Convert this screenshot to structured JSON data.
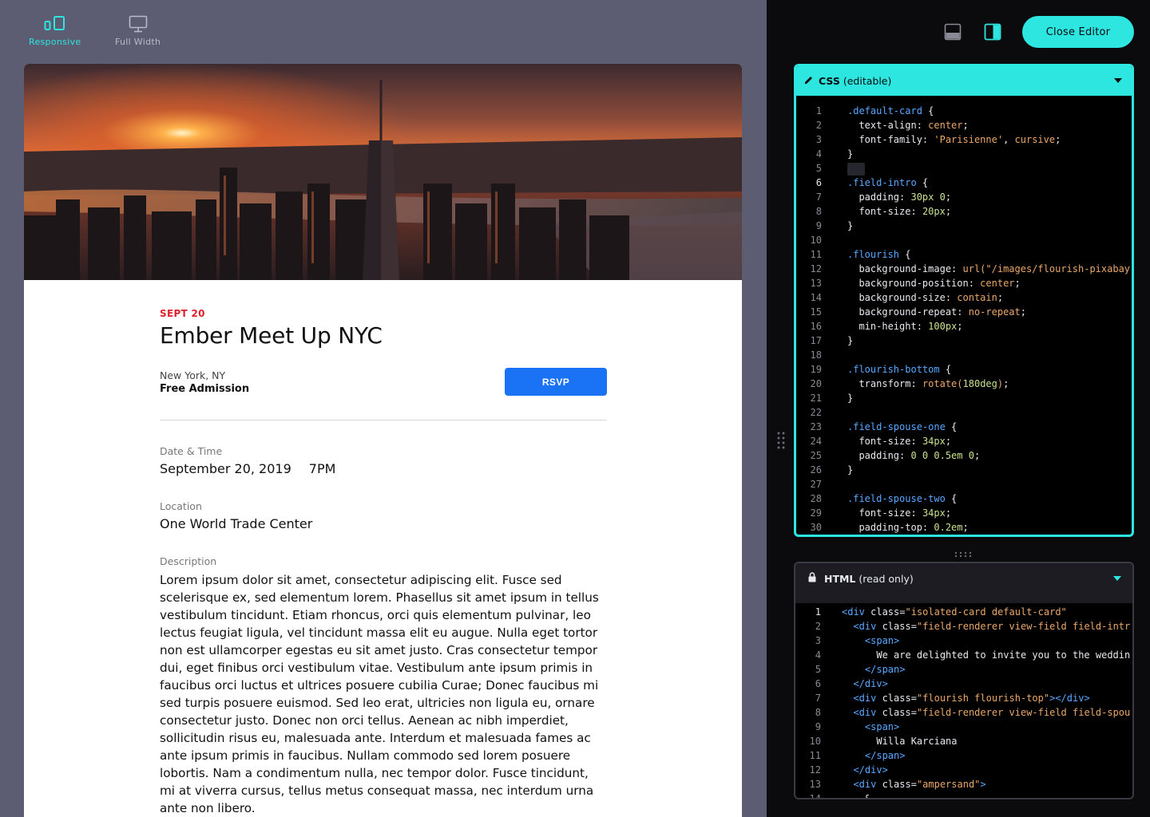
{
  "toolbar": {
    "responsive_label": "Responsive",
    "full_width_label": "Full Width",
    "close_editor_label": "Close Editor"
  },
  "event": {
    "date_tag": "SEPT 20",
    "title": "Ember Meet Up NYC",
    "city": "New York, NY",
    "admission": "Free Admission",
    "rsvp_label": "RSVP",
    "date_time_label": "Date & Time",
    "date_value": "September 20, 2019",
    "time_value": "7PM",
    "location_label": "Location",
    "location_value": "One World Trade Center",
    "description_label": "Description",
    "description": "Lorem ipsum dolor sit amet, consectetur adipiscing elit. Fusce sed scelerisque ex, sed elementum lorem. Phasellus sit amet ipsum in tellus vestibulum tincidunt. Etiam rhoncus, orci quis elementum pulvinar, leo lectus feugiat ligula, vel tincidunt massa elit eu augue. Nulla eget tortor non est ullamcorper egestas eu sit amet justo. Cras consectetur tempor dui, eget finibus orci vestibulum vitae. Vestibulum ante ipsum primis in faucibus orci luctus et ultrices posuere cubilia Curae; Donec faucibus mi sed turpis posuere euismod. Sed leo erat, ultricies non ligula eu, ornare consectetur justo. Donec non orci tellus. Aenean ac nibh imperdiet, sollicitudin risus eu, malesuada ante. Interdum et malesuada fames ac ante ipsum primis in faucibus. Nullam commodo sed lorem posuere lobortis. Nam a condimentum nulla, nec tempor dolor. Fusce tincidunt, mi at viverra cursus, tellus metus consequat massa, nec interdum urna ante non libero."
  },
  "css_pane": {
    "title": "CSS",
    "subtitle": "(editable)",
    "current_line": 6,
    "lines": [
      [
        [
          "sel",
          ".default-card"
        ],
        [
          "punc",
          " {"
        ]
      ],
      [
        [
          "prop",
          "  text-align"
        ],
        [
          "punc",
          ": "
        ],
        [
          "val",
          "center"
        ],
        [
          "punc",
          ";"
        ]
      ],
      [
        [
          "prop",
          "  font-family"
        ],
        [
          "punc",
          ": "
        ],
        [
          "val",
          "'Parisienne'"
        ],
        [
          "punc",
          ", "
        ],
        [
          "val",
          "cursive"
        ],
        [
          "punc",
          ";"
        ]
      ],
      [
        [
          "punc",
          "}"
        ]
      ],
      [],
      [
        [
          "sel",
          ".field-intro"
        ],
        [
          "punc",
          " {"
        ]
      ],
      [
        [
          "prop",
          "  padding"
        ],
        [
          "punc",
          ": "
        ],
        [
          "num",
          "30px 0"
        ],
        [
          "punc",
          ";"
        ]
      ],
      [
        [
          "prop",
          "  font-size"
        ],
        [
          "punc",
          ": "
        ],
        [
          "num",
          "20px"
        ],
        [
          "punc",
          ";"
        ]
      ],
      [
        [
          "punc",
          "}"
        ]
      ],
      [],
      [
        [
          "sel",
          ".flourish"
        ],
        [
          "punc",
          " {"
        ]
      ],
      [
        [
          "prop",
          "  background-image"
        ],
        [
          "punc",
          ": "
        ],
        [
          "fn",
          "url("
        ],
        [
          "val",
          "\"/images/flourish-pixabay-"
        ]
      ],
      [
        [
          "prop",
          "  background-position"
        ],
        [
          "punc",
          ": "
        ],
        [
          "val",
          "center"
        ],
        [
          "punc",
          ";"
        ]
      ],
      [
        [
          "prop",
          "  background-size"
        ],
        [
          "punc",
          ": "
        ],
        [
          "val",
          "contain"
        ],
        [
          "punc",
          ";"
        ]
      ],
      [
        [
          "prop",
          "  background-repeat"
        ],
        [
          "punc",
          ": "
        ],
        [
          "val",
          "no-repeat"
        ],
        [
          "punc",
          ";"
        ]
      ],
      [
        [
          "prop",
          "  min-height"
        ],
        [
          "punc",
          ": "
        ],
        [
          "num",
          "100px"
        ],
        [
          "punc",
          ";"
        ]
      ],
      [
        [
          "punc",
          "}"
        ]
      ],
      [],
      [
        [
          "sel",
          ".flourish-bottom"
        ],
        [
          "punc",
          " {"
        ]
      ],
      [
        [
          "prop",
          "  transform"
        ],
        [
          "punc",
          ": "
        ],
        [
          "fn",
          "rotate("
        ],
        [
          "num",
          "180deg"
        ],
        [
          "fn",
          ")"
        ],
        [
          "punc",
          ";"
        ]
      ],
      [
        [
          "punc",
          "}"
        ]
      ],
      [],
      [
        [
          "sel",
          ".field-spouse-one"
        ],
        [
          "punc",
          " {"
        ]
      ],
      [
        [
          "prop",
          "  font-size"
        ],
        [
          "punc",
          ": "
        ],
        [
          "num",
          "34px"
        ],
        [
          "punc",
          ";"
        ]
      ],
      [
        [
          "prop",
          "  padding"
        ],
        [
          "punc",
          ": "
        ],
        [
          "num",
          "0 0 0.5em 0"
        ],
        [
          "punc",
          ";"
        ]
      ],
      [
        [
          "punc",
          "}"
        ]
      ],
      [],
      [
        [
          "sel",
          ".field-spouse-two"
        ],
        [
          "punc",
          " {"
        ]
      ],
      [
        [
          "prop",
          "  font-size"
        ],
        [
          "punc",
          ": "
        ],
        [
          "num",
          "34px"
        ],
        [
          "punc",
          ";"
        ]
      ],
      [
        [
          "prop",
          "  padding-top"
        ],
        [
          "punc",
          ": "
        ],
        [
          "num",
          "0.2em"
        ],
        [
          "punc",
          ";"
        ]
      ]
    ]
  },
  "html_pane": {
    "title": "HTML",
    "subtitle": "(read only)",
    "current_line": 1,
    "lines": [
      [
        [
          "tag",
          "<div "
        ],
        [
          "attr",
          "class"
        ],
        [
          "punc",
          "="
        ],
        [
          "str",
          "\"isolated-card default-card\""
        ]
      ],
      [
        [
          "tag",
          "  <div "
        ],
        [
          "attr",
          "class"
        ],
        [
          "punc",
          "="
        ],
        [
          "str",
          "\"field-renderer view-field field-intr"
        ]
      ],
      [
        [
          "tag",
          "    <span>"
        ]
      ],
      [
        [
          "txt",
          "      We are delighted to invite you to the weddin"
        ]
      ],
      [
        [
          "tag",
          "    </span>"
        ]
      ],
      [
        [
          "tag",
          "  </div>"
        ]
      ],
      [
        [
          "tag",
          "  <div "
        ],
        [
          "attr",
          "class"
        ],
        [
          "punc",
          "="
        ],
        [
          "str",
          "\"flourish flourish-top\""
        ],
        [
          "tag",
          "></div>"
        ]
      ],
      [
        [
          "tag",
          "  <div "
        ],
        [
          "attr",
          "class"
        ],
        [
          "punc",
          "="
        ],
        [
          "str",
          "\"field-renderer view-field field-spou"
        ]
      ],
      [
        [
          "tag",
          "    <span>"
        ]
      ],
      [
        [
          "txt",
          "      Willa Karciana"
        ]
      ],
      [
        [
          "tag",
          "    </span>"
        ]
      ],
      [
        [
          "tag",
          "  </div>"
        ]
      ],
      [
        [
          "tag",
          "  <div "
        ],
        [
          "attr",
          "class"
        ],
        [
          "punc",
          "="
        ],
        [
          "str",
          "\"ampersand\""
        ],
        [
          "tag",
          ">"
        ]
      ],
      [
        [
          "txt",
          "    &"
        ]
      ]
    ]
  },
  "colors": {
    "accent": "#2de6e0",
    "rsvp": "#1a73f5",
    "date_tag": "#e0212d",
    "preview_bg": "#5c5d72",
    "editor_bg": "#0b0b0d"
  },
  "icons": {
    "responsive": "devices-icon",
    "full_width": "monitor-icon",
    "panel_bottom": "panel-bottom-icon",
    "panel_right": "panel-right-icon",
    "edit": "pencil-icon",
    "lock": "lock-icon"
  }
}
